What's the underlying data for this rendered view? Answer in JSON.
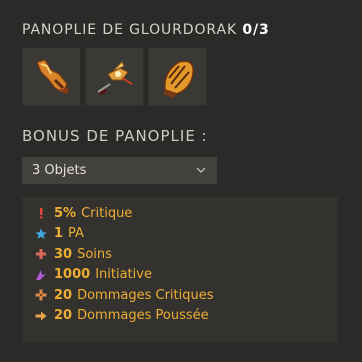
{
  "set": {
    "title": "PANOPLIE DE GLOURDORAK",
    "count": "0/3",
    "items": [
      {
        "icon": "glourdorak-boots-icon"
      },
      {
        "icon": "glourdorak-amulet-icon"
      },
      {
        "icon": "glourdorak-hat-icon"
      }
    ]
  },
  "bonus": {
    "title": "BONUS DE PANOPLIE :",
    "selected_option": "3 Objets",
    "lines": [
      {
        "icon": "critical-icon",
        "icon_color": "#e6473a",
        "value": "5%",
        "label": "Critique"
      },
      {
        "icon": "ap-star-icon",
        "icon_color": "#3fa8e0",
        "value": "1",
        "label": "PA"
      },
      {
        "icon": "heals-icon",
        "icon_color": "#d96a5a",
        "value": "30",
        "label": "Soins"
      },
      {
        "icon": "initiative-icon",
        "icon_color": "#b35bd6",
        "value": "1000",
        "label": "Initiative"
      },
      {
        "icon": "critical-damage-icon",
        "icon_color": "#d98a4a",
        "value": "20",
        "label": "Dommages Critiques"
      },
      {
        "icon": "pushback-damage-icon",
        "icon_color": "#e8a24a",
        "value": "20",
        "label": "Dommages Poussée"
      }
    ]
  },
  "colors": {
    "background": "#2a2a28",
    "panel": "#33322f",
    "accent": "#eeae33"
  }
}
